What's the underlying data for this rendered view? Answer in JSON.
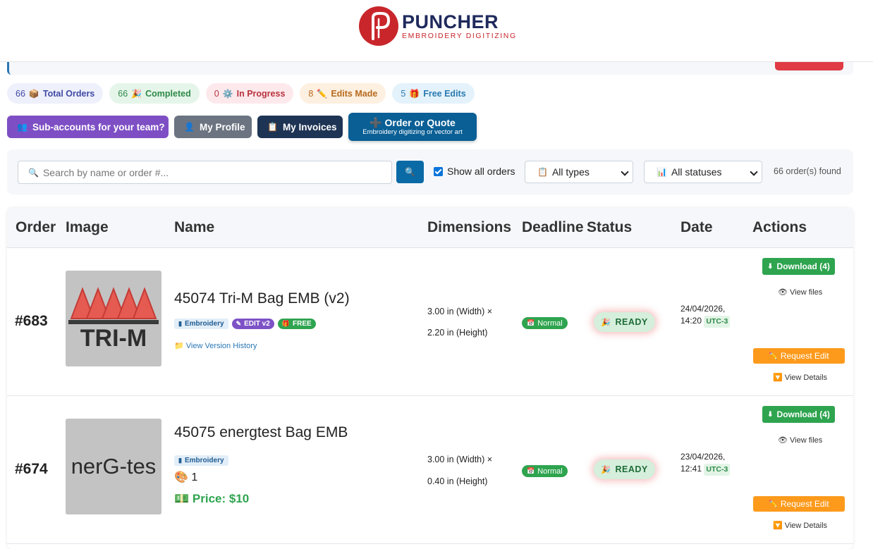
{
  "brand": {
    "name": "PUNCHER",
    "tagline": "EMBROIDERY DIGITIZING"
  },
  "stats": [
    {
      "count": "66",
      "icon": "📦",
      "label": "Total Orders"
    },
    {
      "count": "66",
      "icon": "🎉",
      "label": "Completed"
    },
    {
      "count": "0",
      "icon": "⚙️",
      "label": "In Progress"
    },
    {
      "count": "8",
      "icon": "✏️",
      "label": "Edits Made"
    },
    {
      "count": "5",
      "icon": "🎁",
      "label": "Free Edits"
    }
  ],
  "actions": {
    "subaccounts": {
      "icon": "👥",
      "label": "Sub-accounts for your team?"
    },
    "profile": {
      "icon": "👤",
      "label": "My Profile"
    },
    "invoices": {
      "icon": "📋",
      "label": "My Invoices"
    },
    "order": {
      "icon": "➕",
      "label": "Order or Quote",
      "sub": "Embroidery digitizing or vector art"
    }
  },
  "filters": {
    "search_icon": "🔍",
    "search_placeholder": "Search by name or order #...",
    "search_button_icon": "🔍",
    "show_all_label": "Show all orders",
    "show_all_checked": true,
    "type_icon": "📋",
    "type_value": "All types",
    "status_icon": "📊",
    "status_value": "All statuses",
    "found_text": "66 order(s) found"
  },
  "table": {
    "headers": {
      "order": "Order",
      "image": "Image",
      "name": "Name",
      "dimensions": "Dimensions",
      "deadline": "Deadline",
      "status": "Status",
      "date": "Date",
      "actions": "Actions"
    },
    "rows": [
      {
        "order": "#683",
        "name": "45074 Tri-M Bag EMB (v2)",
        "thumb_text": "TRI-M",
        "tag_emb": "Embroidery",
        "tag_edit": "EDIT v2",
        "tag_free": "FREE",
        "version_history": "View Version History",
        "dim_w": "3.00 in (Width) ×",
        "dim_h": "2.20 in (Height)",
        "deadline": "Normal",
        "status": "READY",
        "date1": "24/04/2026,",
        "date2": "14:20",
        "utc": "UTC-3",
        "download": "Download (4)",
        "view_files": "View files",
        "request_edit": "Request Edit",
        "view_details": "View Details"
      },
      {
        "order": "#674",
        "name": "45075 energtest Bag EMB",
        "thumb_text": "nerG-tes",
        "tag_emb": "Embroidery",
        "palette_icon": "🎨",
        "palette_count": "1",
        "price_icon": "💵",
        "price": "Price: $10",
        "dim_w": "3.00 in (Width) ×",
        "dim_h": "0.40 in (Height)",
        "deadline": "Normal",
        "status": "READY",
        "date1": "23/04/2026,",
        "date2": "12:41",
        "utc": "UTC-3",
        "download": "Download (4)",
        "view_files": "View files",
        "request_edit": "Request Edit",
        "view_details": "View Details"
      }
    ]
  },
  "colors": {
    "brand_red": "#c8262b",
    "brand_navy": "#1f2a5c",
    "ready_green": "#2ea44f",
    "request_orange": "#fd9a1c"
  }
}
